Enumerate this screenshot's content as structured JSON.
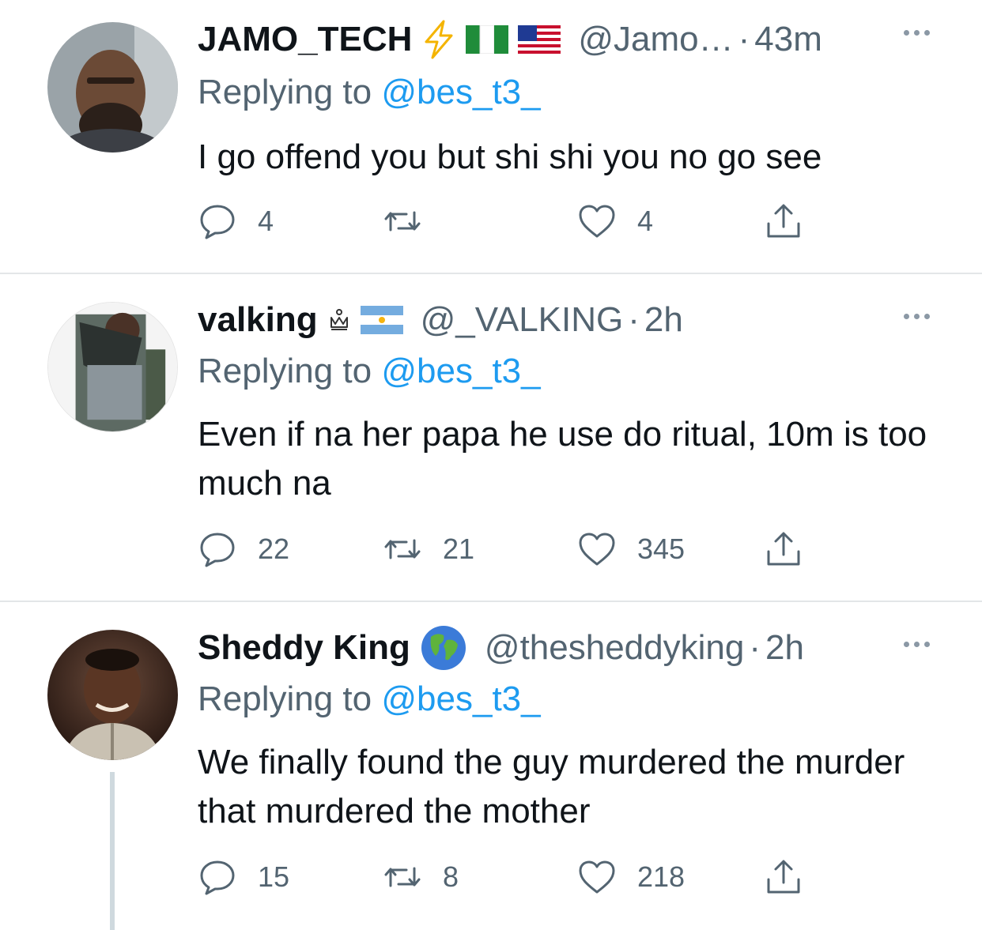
{
  "replying_prefix": "Replying to ",
  "colors": {
    "link": "#1d9bf0",
    "secondary": "#536471",
    "divider": "#e3e6e8"
  },
  "tweets": [
    {
      "name": "JAMO_TECH",
      "badges": [
        "lightning-emoji",
        "nigeria-flag",
        "usa-flag"
      ],
      "handle": "@Jamo…",
      "separator": "·",
      "time": "43m",
      "reply_to": "@bes_t3_",
      "text": "I go offend you but shi shi you no go see",
      "replies": "4",
      "retweets": "",
      "likes": "4"
    },
    {
      "name": "valking",
      "badges": [
        "crown-symbol",
        "argentina-flag"
      ],
      "handle": "@_VALKING",
      "separator": "·",
      "time": "2h",
      "reply_to": "@bes_t3_",
      "text": "Even if na her papa he use do ritual, 10m is too much na",
      "replies": "22",
      "retweets": "21",
      "likes": "345"
    },
    {
      "name": "Sheddy King",
      "badges": [
        "globe-emoji"
      ],
      "handle": "@thesheddyking",
      "separator": "·",
      "time": "2h",
      "reply_to": "@bes_t3_",
      "text": "We finally found the guy murdered the murder that murdered the mother",
      "replies": "15",
      "retweets": "8",
      "likes": "218"
    }
  ]
}
